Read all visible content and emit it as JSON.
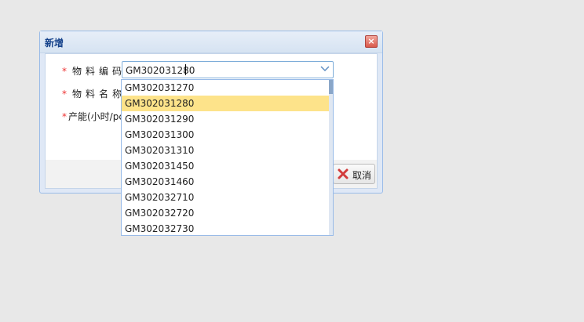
{
  "dialog": {
    "title": "新增",
    "close_icon": "close-icon",
    "fields": {
      "code_label": "物料编码:",
      "name_label": "物料名称:",
      "capacity_label": "产能(小时/pc",
      "required_mark": "*"
    },
    "combo": {
      "value": "GM302031280",
      "arrow_icon": "chevron-down-icon"
    },
    "cancel_button": {
      "label": "取消",
      "icon": "close-x-icon"
    }
  },
  "dropdown": {
    "selected": "GM302031280",
    "items": [
      "GM302031270",
      "GM302031280",
      "GM302031290",
      "GM302031300",
      "GM302031310",
      "GM302031450",
      "GM302031460",
      "GM302032710",
      "GM302032720",
      "GM302032730"
    ]
  },
  "colors": {
    "selected_bg": "#fde38a",
    "required": "#ee3333",
    "title": "#15428b"
  }
}
